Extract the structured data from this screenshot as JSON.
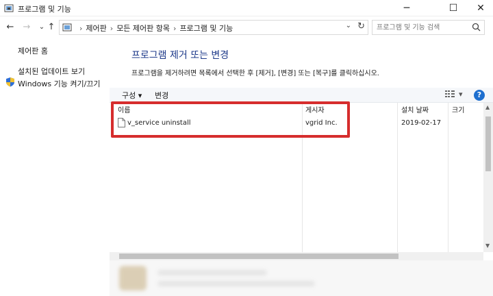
{
  "window": {
    "title": "프로그램 및 기능",
    "minimize_glyph": "─",
    "maximize_glyph": "☐",
    "close_glyph": "✕"
  },
  "nav": {
    "back_glyph": "←",
    "forward_glyph": "→",
    "dropdown_glyph": "⌄",
    "up_glyph": "↑"
  },
  "address": {
    "crumbs": [
      "제어판",
      "모든 제어판 항목",
      "프로그램 및 기능"
    ],
    "separator": "›",
    "dropdown_glyph": "⌄",
    "refresh_glyph": "↻"
  },
  "search": {
    "placeholder": "프로그램 및 기능 검색"
  },
  "sidebar": {
    "items": [
      {
        "label": "제어판 홈"
      },
      {
        "label": "설치된 업데이트 보기"
      },
      {
        "label": "Windows 기능 켜기/끄기"
      }
    ]
  },
  "main": {
    "title": "프로그램 제거 또는 변경",
    "description": "프로그램을 제거하려면 목록에서 선택한 후 [제거], [변경] 또는 [복구]를 클릭하십시오."
  },
  "toolbar": {
    "organize_label": "구성",
    "organize_arrow": "▾",
    "change_label": "변경",
    "view_arrow": "▾",
    "help_label": "?"
  },
  "table": {
    "columns": [
      "이름",
      "게시자",
      "설치 날짜",
      "크기"
    ],
    "rows": [
      {
        "name": "v_service uninstall",
        "publisher": "vgrid Inc.",
        "installed": "2019-02-17",
        "size": ""
      }
    ]
  },
  "colors": {
    "accent": "#1e3a8a",
    "highlight_border": "#d62d2d",
    "help_button": "#1e6fcf"
  }
}
